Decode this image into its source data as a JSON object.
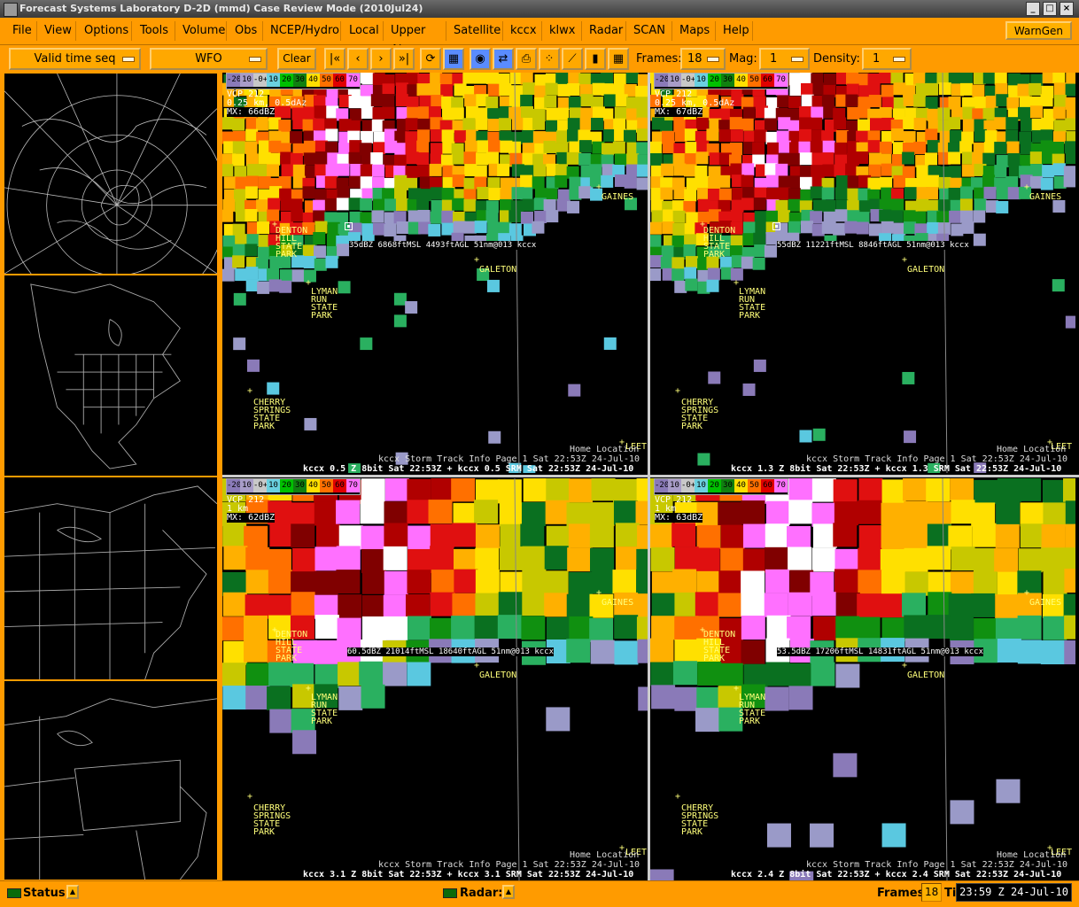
{
  "window": {
    "title": "Forecast Systems Laboratory D-2D (mmd) Case Review Mode (2010Jul24)"
  },
  "menu": [
    "File",
    "View",
    "Options",
    "Tools",
    "Volume",
    "Obs",
    "NCEP/Hydro",
    "Local",
    "Upper Air",
    "Satellite",
    "kccx",
    "klwx",
    "Radar",
    "SCAN",
    "Maps",
    "Help"
  ],
  "warngen": "WarnGen",
  "toolbar": {
    "time_mode": "Valid time seq",
    "scale": "WFO",
    "clear": "Clear",
    "frames_label": "Frames:",
    "frames_value": "18",
    "mag_label": "Mag:",
    "mag_value": "1",
    "density_label": "Density:",
    "density_value": "1",
    "icons": [
      "first-frame-icon",
      "prev-frame-icon",
      "next-frame-icon",
      "last-frame-icon",
      "loop-icon",
      "image-properties-icon",
      "refresh-icon",
      "swap-icon",
      "print-icon",
      "points-icon",
      "baseline-icon",
      "single-panel-icon",
      "four-panel-icon"
    ]
  },
  "colorbar": {
    "labels": [
      "-20",
      "10",
      "-0+",
      "10",
      "20",
      "30",
      "40",
      "50",
      "60",
      "70"
    ],
    "colors": [
      "#8a7ab8",
      "#a89cc8",
      "#c8c8c8",
      "#6ad0e0",
      "#00c000",
      "#108010",
      "#ffe000",
      "#ff7000",
      "#e00000",
      "#ff70ff"
    ]
  },
  "towns": {
    "denton": "DENTON\nHILL\nSTATE\nPARK",
    "lyman": "LYMAN\nRUN\nSTATE\nPARK",
    "cherry": "CHERRY\nSPRINGS\nSTATE\nPARK",
    "galeton": "GALETON",
    "gaines": "GAINES",
    "leet": "LEET"
  },
  "panels": [
    {
      "vcp": "VCP 212",
      "res": "0.25 km, 0.5dAz",
      "mx": "MX: 66dBZ",
      "sample": "35dBZ 6868ftMSL 4493ftAGL 51nm@013 kccx",
      "home": "Home Location",
      "storm": "kccx Storm Track Info Page 1  Sat 22:53Z 24-Jul-10",
      "main": "kccx 0.5 Z  8bit Sat 22:53Z + kccx 0.5 SRM  Sat 22:53Z 24-Jul-10"
    },
    {
      "vcp": "VCP 212",
      "res": "0.25 km, 0.5dAz",
      "mx": "MX: 67dBZ",
      "sample": "55dBZ 11221ftMSL 8846ftAGL 51nm@013 kccx",
      "home": "Home Location",
      "storm": "kccx Storm Track Info Page 1  Sat 22:53Z 24-Jul-10",
      "main": "kccx 1.3 Z  8bit Sat 22:53Z + kccx 1.3 SRM  Sat 22:53Z 24-Jul-10"
    },
    {
      "vcp": "VCP 212",
      "res": "1 km",
      "mx": "MX: 62dBZ",
      "sample": "60.5dBZ 21014ftMSL 18640ftAGL 51nm@013 kccx",
      "home": "Home Location",
      "storm": "kccx Storm Track Info Page 1  Sat 22:53Z 24-Jul-10",
      "main": "kccx 3.1 Z  8bit Sat 22:53Z + kccx 3.1 SRM  Sat 22:53Z 24-Jul-10"
    },
    {
      "vcp": "VCP 212",
      "res": "1 km",
      "mx": "MX: 63dBZ",
      "sample": "53.5dBZ 17206ftMSL 14831ftAGL 51nm@013 kccx",
      "home": "Home Location",
      "storm": "kccx Storm Track Info Page 1  Sat 22:53Z 24-Jul-10",
      "main": "kccx 2.4 Z  8bit Sat 22:53Z + kccx 2.4 SRM  Sat 22:53Z 24-Jul-10"
    }
  ],
  "statusbar": {
    "status_label": "Status:",
    "radar_label": "Radar:",
    "frames_label": "Frames:",
    "frames_value": "18",
    "time_label": "Time:",
    "time_value": "23:59 Z 24-Jul-10"
  }
}
